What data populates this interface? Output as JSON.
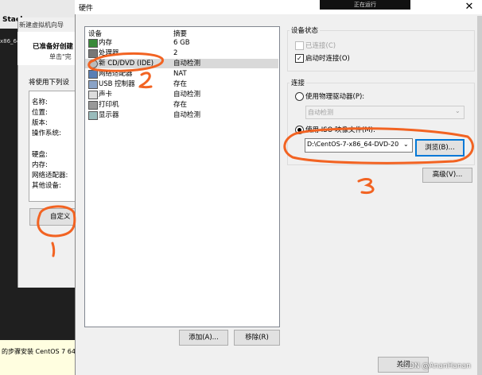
{
  "background": {
    "tab_label": "Stack",
    "arch_fragment": "x86_64",
    "bottom_hint": "的步骤安装 CentOS 7 64"
  },
  "wizard": {
    "title": "新建虚拟机向导",
    "heading": "已准备好创建",
    "subheading": "单击\"完",
    "settings_label": "将使用下列设",
    "labels": [
      "名称:",
      "位置:",
      "版本:",
      "操作系统:",
      "硬盘:",
      "内存:",
      "网络适配器:",
      "其他设备:"
    ],
    "customize_button": "自定义"
  },
  "top_bar_fragment": "正在运行",
  "dialog": {
    "title": "硬件",
    "close_glyph": "✕",
    "device_list": {
      "columns": {
        "device": "设备",
        "summary": "摘要"
      },
      "rows": [
        {
          "name": "内存",
          "summary": "6 GB"
        },
        {
          "name": "处理器",
          "summary": "2"
        },
        {
          "name": "新 CD/DVD (IDE)",
          "summary": "自动检测"
        },
        {
          "name": "网络适配器",
          "summary": "NAT"
        },
        {
          "name": "USB 控制器",
          "summary": "存在"
        },
        {
          "name": "声卡",
          "summary": "自动检测"
        },
        {
          "name": "打印机",
          "summary": "存在"
        },
        {
          "name": "显示器",
          "summary": "自动检测"
        }
      ]
    },
    "add_button": "添加(A)...",
    "remove_button": "移除(R)",
    "device_status": {
      "title": "设备状态",
      "connected": "已连接(C)",
      "connect_at_power_on": "启动时连接(O)"
    },
    "connection": {
      "title": "连接",
      "physical_drive": "使用物理驱动器(P):",
      "physical_drive_value": "自动检测",
      "use_iso": "使用 ISO 映像文件(M):",
      "iso_path": "D:\\CentOS-7-x86_64-DVD-20",
      "browse_button": "浏览(B)..."
    },
    "advanced_button": "高级(V)...",
    "ok_button": "关闭"
  },
  "annotations": {
    "mark1": "1",
    "mark2": "2",
    "mark3": "3"
  },
  "watermark": "CSDN @AnanHanan",
  "colors": {
    "annotation": "#f26322",
    "focus": "#0078d7"
  }
}
